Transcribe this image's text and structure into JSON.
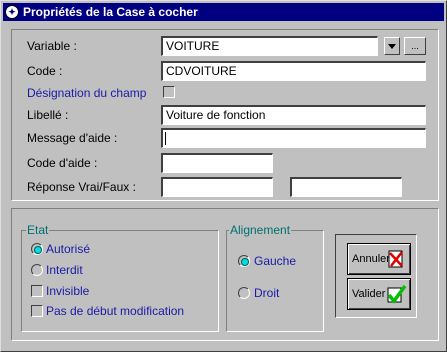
{
  "window": {
    "title": "Propriétés de la Case à cocher",
    "icon": "app-icon"
  },
  "form": {
    "variable": {
      "label": "Variable :",
      "value": "VOITURE"
    },
    "code": {
      "label": "Code :",
      "value": "CDVOITURE"
    },
    "designation": {
      "label": "Désignation du champ",
      "checked": false
    },
    "libelle": {
      "label": "Libellé :",
      "value": "Voiture de fonction"
    },
    "message_aide": {
      "label": "Message d'aide :",
      "value": ""
    },
    "code_aide": {
      "label": "Code d'aide :",
      "value": ""
    },
    "reponse": {
      "label": "Réponse Vrai/Faux :",
      "vrai": "",
      "faux": ""
    },
    "dropdown_icon": "triangle-down-icon",
    "browse_label": "..."
  },
  "etat": {
    "title": "Etat",
    "autorise": {
      "label": "Autorisé",
      "selected": true
    },
    "interdit": {
      "label": "Interdit",
      "selected": false
    },
    "invisible": {
      "label": "Invisible",
      "checked": false
    },
    "pas_debut": {
      "label": "Pas de début modification",
      "checked": false
    }
  },
  "alignement": {
    "title": "Alignement",
    "gauche": {
      "label": "Gauche",
      "selected": true
    },
    "droit": {
      "label": "Droit",
      "selected": false
    }
  },
  "actions": {
    "annuler": {
      "label": "Annuler",
      "icon": "red-cross-icon"
    },
    "valider": {
      "label": "Valider",
      "icon": "green-check-icon"
    }
  },
  "colors": {
    "titlebar": "#000080",
    "face": "#c0c0c0",
    "group_title": "#007070",
    "option_text": "#1a1aa6"
  }
}
